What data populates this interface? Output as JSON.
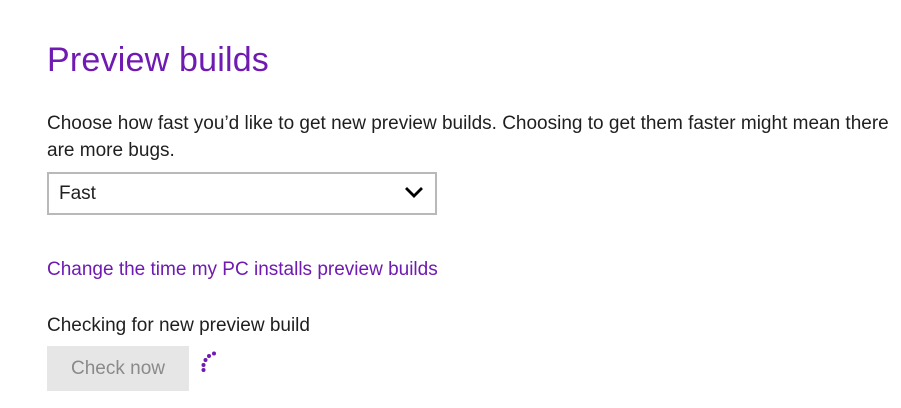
{
  "page": {
    "title": "Preview builds",
    "description": "Choose how fast you’d like to get new preview builds. Choosing to get them faster might mean there are more bugs."
  },
  "ring_select": {
    "selected": "Fast",
    "icon": "chevron-down-icon"
  },
  "schedule_link": {
    "label": "Change the time my PC installs preview builds"
  },
  "status": {
    "text": "Checking for new preview build"
  },
  "check_button": {
    "label": "Check now",
    "disabled": true
  },
  "progress": {
    "icon": "progress-ring-icon"
  },
  "colors": {
    "accent": "#6f1ab1",
    "text": "#1f1f1f",
    "disabled_bg": "#e6e6e6",
    "disabled_text": "#8a8a8a",
    "border": "#b9b9b9"
  }
}
